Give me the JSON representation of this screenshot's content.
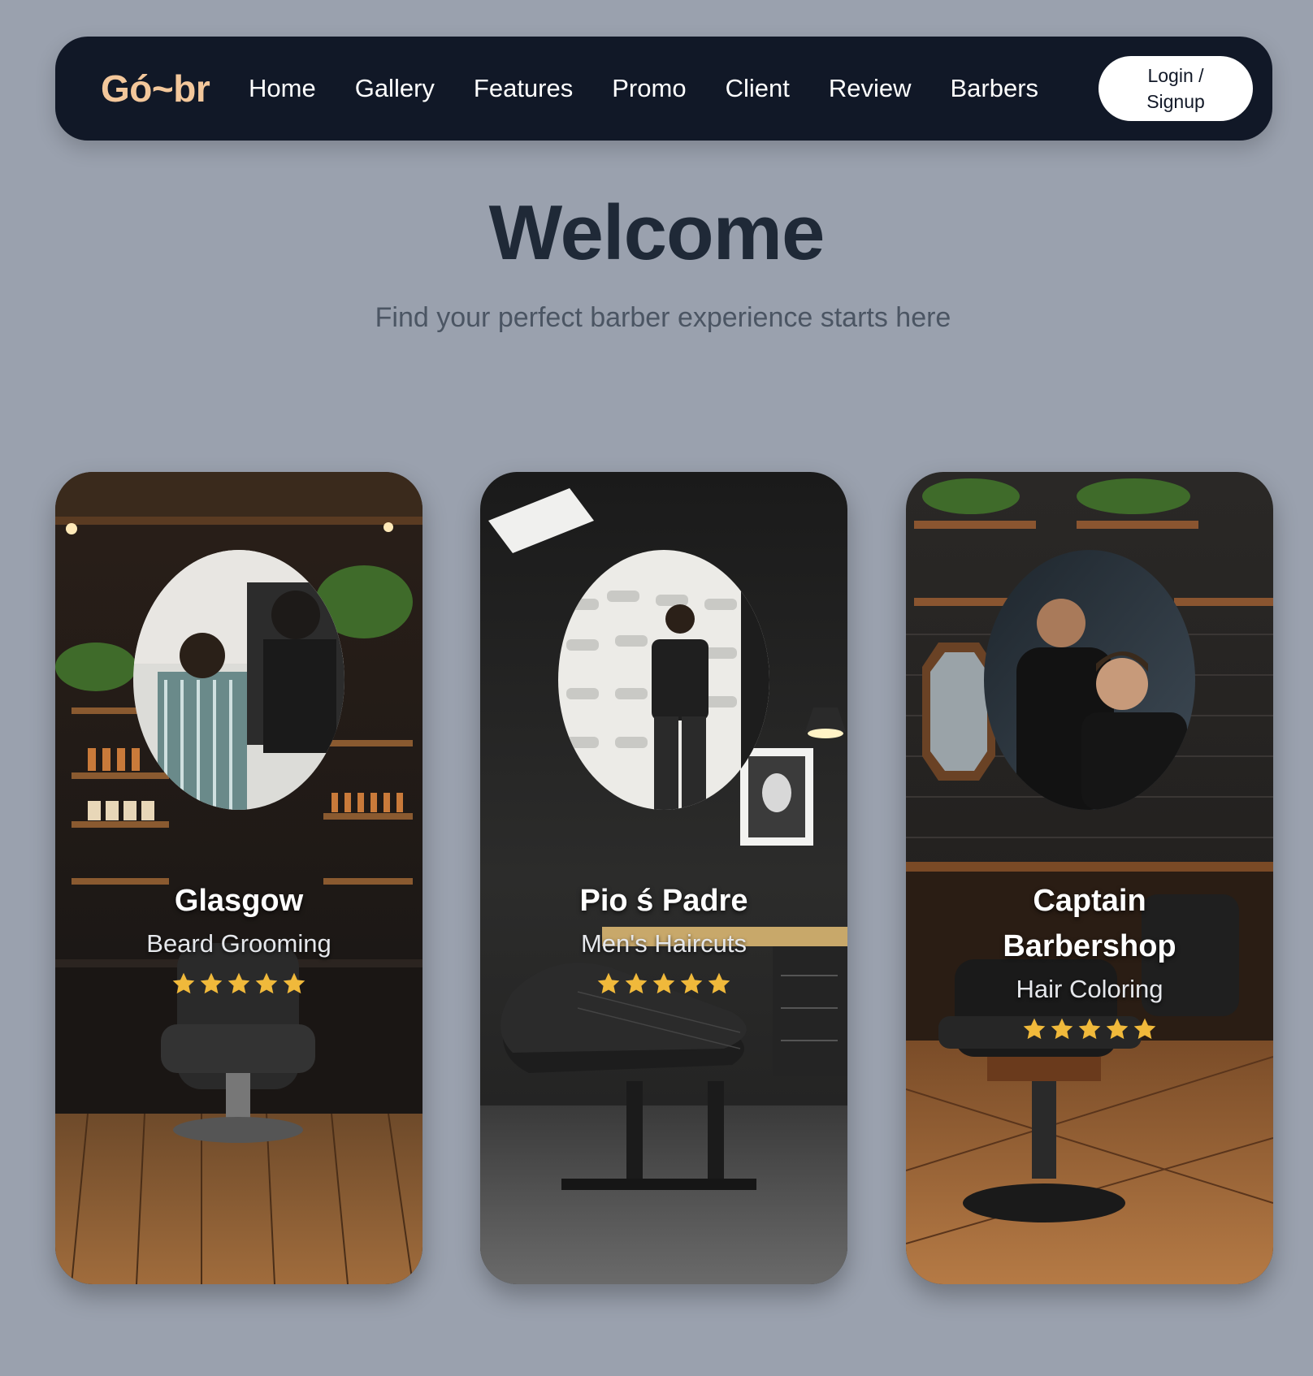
{
  "navbar": {
    "logo": "Gó~br",
    "links": [
      "Home",
      "Gallery",
      "Features",
      "Promo",
      "Client",
      "Review",
      "Barbers"
    ],
    "login_label": "Login / Signup"
  },
  "hero": {
    "title": "Welcome",
    "subtitle": "Find your perfect barber experience starts here"
  },
  "cards": [
    {
      "name": "Glasgow",
      "service": "Beard Grooming",
      "rating": 5
    },
    {
      "name": "Pio ś Padre",
      "service": "Men's Haircuts",
      "rating": 5
    },
    {
      "name": "Captain Barbershop",
      "service": "Hair Coloring",
      "rating": 5
    }
  ],
  "colors": {
    "page_background": "#9aa1ae",
    "navbar_background": "#111827",
    "logo": "#f3c79b",
    "title": "#1f2937",
    "subtitle": "#4b5563",
    "star": "#f0b93b"
  },
  "icons": {
    "star": "star-icon"
  }
}
